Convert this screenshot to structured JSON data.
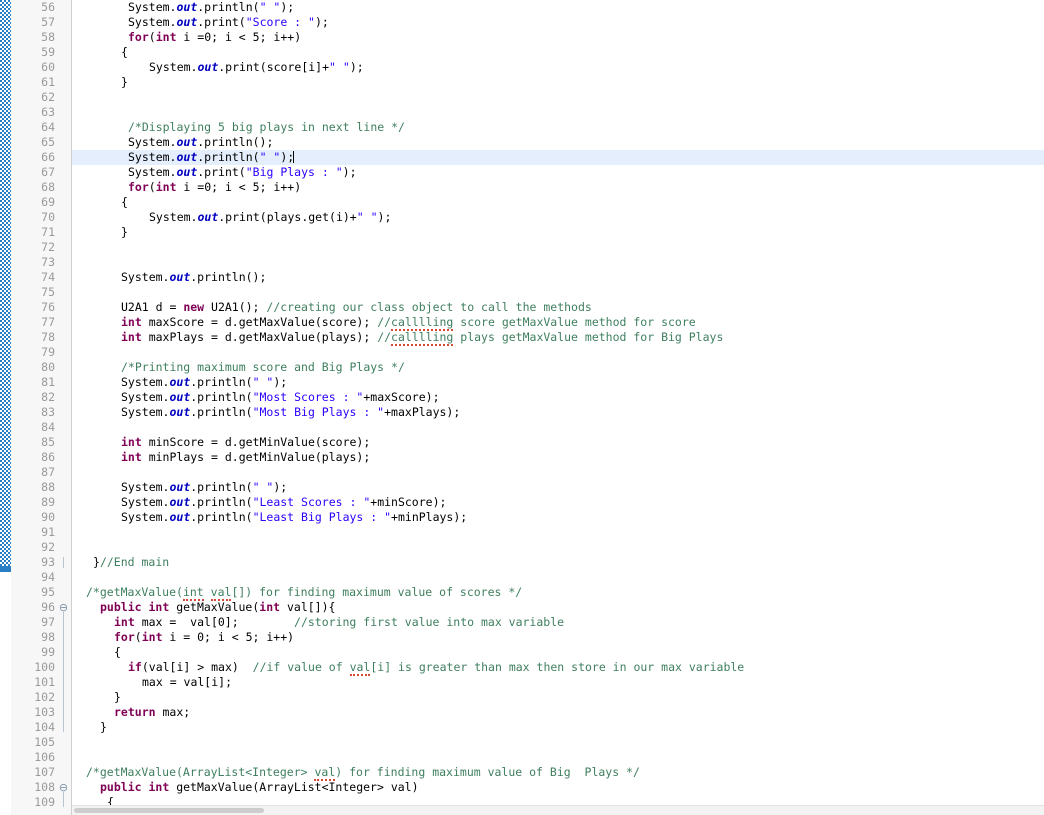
{
  "editor": {
    "language": "Java",
    "first_line": 56,
    "line_height": 15,
    "active_line": 66,
    "colors": {
      "background": "#ffffff",
      "gutter_background": "#f7f7f7",
      "line_number": "#9a9a9a",
      "active_line_highlight": "#e4eefc",
      "keyword": "#7f0055",
      "string": "#2a00ff",
      "comment": "#3f7f5f",
      "static_field": "#0000c0",
      "text": "#000000",
      "change_bar": "#2a7fc4",
      "spellcheck_underline": "#d84a38"
    },
    "fold_markers": [
      {
        "line": 96,
        "glyph": "⊖",
        "state": "expanded"
      },
      {
        "line": 108,
        "glyph": "⊖",
        "state": "expanded"
      }
    ],
    "scrollbar": {
      "orientation": "horizontal",
      "thumb_label": "horizontal-scroll-thumb"
    }
  },
  "lines": [
    {
      "n": 56,
      "indent": 8,
      "tokens": [
        {
          "t": "plain",
          "s": "System."
        },
        {
          "t": "fld",
          "s": "out"
        },
        {
          "t": "plain",
          "s": ".println("
        },
        {
          "t": "str",
          "s": "\" \""
        },
        {
          "t": "plain",
          "s": ");"
        }
      ]
    },
    {
      "n": 57,
      "indent": 8,
      "tokens": [
        {
          "t": "plain",
          "s": "System."
        },
        {
          "t": "fld",
          "s": "out"
        },
        {
          "t": "plain",
          "s": ".print("
        },
        {
          "t": "str",
          "s": "\"Score : \""
        },
        {
          "t": "plain",
          "s": ");"
        }
      ]
    },
    {
      "n": 58,
      "indent": 8,
      "tokens": [
        {
          "t": "kw",
          "s": "for"
        },
        {
          "t": "plain",
          "s": "("
        },
        {
          "t": "kw",
          "s": "int"
        },
        {
          "t": "plain",
          "s": " i =0; i < 5; i++)"
        }
      ]
    },
    {
      "n": 59,
      "indent": 7,
      "tokens": [
        {
          "t": "plain",
          "s": "{"
        }
      ]
    },
    {
      "n": 60,
      "indent": 11,
      "tokens": [
        {
          "t": "plain",
          "s": "System."
        },
        {
          "t": "fld",
          "s": "out"
        },
        {
          "t": "plain",
          "s": ".print(score[i]+"
        },
        {
          "t": "str",
          "s": "\" \""
        },
        {
          "t": "plain",
          "s": ");"
        }
      ]
    },
    {
      "n": 61,
      "indent": 7,
      "tokens": [
        {
          "t": "plain",
          "s": "}"
        }
      ]
    },
    {
      "n": 62,
      "indent": 0,
      "tokens": []
    },
    {
      "n": 63,
      "indent": 0,
      "tokens": []
    },
    {
      "n": 64,
      "indent": 8,
      "tokens": [
        {
          "t": "cmt",
          "s": "/*Displaying 5 big plays in next line */"
        }
      ]
    },
    {
      "n": 65,
      "indent": 8,
      "tokens": [
        {
          "t": "plain",
          "s": "System."
        },
        {
          "t": "fld",
          "s": "out"
        },
        {
          "t": "plain",
          "s": ".println();"
        }
      ]
    },
    {
      "n": 66,
      "indent": 8,
      "active": true,
      "tokens": [
        {
          "t": "plain",
          "s": "System."
        },
        {
          "t": "fld",
          "s": "out"
        },
        {
          "t": "plain",
          "s": ".println("
        },
        {
          "t": "str",
          "s": "\" \""
        },
        {
          "t": "plain",
          "s": ");"
        },
        {
          "t": "caret",
          "s": ""
        }
      ]
    },
    {
      "n": 67,
      "indent": 8,
      "tokens": [
        {
          "t": "plain",
          "s": "System."
        },
        {
          "t": "fld",
          "s": "out"
        },
        {
          "t": "plain",
          "s": ".print("
        },
        {
          "t": "str",
          "s": "\"Big Plays : \""
        },
        {
          "t": "plain",
          "s": ");"
        }
      ]
    },
    {
      "n": 68,
      "indent": 8,
      "tokens": [
        {
          "t": "kw",
          "s": "for"
        },
        {
          "t": "plain",
          "s": "("
        },
        {
          "t": "kw",
          "s": "int"
        },
        {
          "t": "plain",
          "s": " i =0; i < 5; i++)"
        }
      ]
    },
    {
      "n": 69,
      "indent": 7,
      "tokens": [
        {
          "t": "plain",
          "s": "{"
        }
      ]
    },
    {
      "n": 70,
      "indent": 11,
      "tokens": [
        {
          "t": "plain",
          "s": "System."
        },
        {
          "t": "fld",
          "s": "out"
        },
        {
          "t": "plain",
          "s": ".print(plays.get(i)+"
        },
        {
          "t": "str",
          "s": "\" \""
        },
        {
          "t": "plain",
          "s": ");"
        }
      ]
    },
    {
      "n": 71,
      "indent": 7,
      "tokens": [
        {
          "t": "plain",
          "s": "}"
        }
      ]
    },
    {
      "n": 72,
      "indent": 0,
      "tokens": []
    },
    {
      "n": 73,
      "indent": 0,
      "tokens": []
    },
    {
      "n": 74,
      "indent": 7,
      "tokens": [
        {
          "t": "plain",
          "s": "System."
        },
        {
          "t": "fld",
          "s": "out"
        },
        {
          "t": "plain",
          "s": ".println();"
        }
      ]
    },
    {
      "n": 75,
      "indent": 0,
      "tokens": []
    },
    {
      "n": 76,
      "indent": 7,
      "tokens": [
        {
          "t": "plain",
          "s": "U2A1 d = "
        },
        {
          "t": "kw",
          "s": "new"
        },
        {
          "t": "plain",
          "s": " U2A1(); "
        },
        {
          "t": "cmt",
          "s": "//creating our class object to call the methods"
        }
      ]
    },
    {
      "n": 77,
      "indent": 7,
      "tokens": [
        {
          "t": "kw",
          "s": "int"
        },
        {
          "t": "plain",
          "s": " maxScore = d.getMaxValue(score); "
        },
        {
          "t": "cmt",
          "s": "//"
        },
        {
          "t": "cmt-spell",
          "s": "calllling"
        },
        {
          "t": "cmt",
          "s": " score getMaxValue method for score"
        }
      ]
    },
    {
      "n": 78,
      "indent": 7,
      "tokens": [
        {
          "t": "kw",
          "s": "int"
        },
        {
          "t": "plain",
          "s": " maxPlays = d.getMaxValue(plays); "
        },
        {
          "t": "cmt",
          "s": "//"
        },
        {
          "t": "cmt-spell",
          "s": "calllling"
        },
        {
          "t": "cmt",
          "s": " plays getMaxValue method for Big Plays"
        }
      ]
    },
    {
      "n": 79,
      "indent": 0,
      "tokens": []
    },
    {
      "n": 80,
      "indent": 7,
      "tokens": [
        {
          "t": "cmt",
          "s": "/*Printing maximum score and Big Plays */"
        }
      ]
    },
    {
      "n": 81,
      "indent": 7,
      "tokens": [
        {
          "t": "plain",
          "s": "System."
        },
        {
          "t": "fld",
          "s": "out"
        },
        {
          "t": "plain",
          "s": ".println("
        },
        {
          "t": "str",
          "s": "\" \""
        },
        {
          "t": "plain",
          "s": ");"
        }
      ]
    },
    {
      "n": 82,
      "indent": 7,
      "tokens": [
        {
          "t": "plain",
          "s": "System."
        },
        {
          "t": "fld",
          "s": "out"
        },
        {
          "t": "plain",
          "s": ".println("
        },
        {
          "t": "str",
          "s": "\"Most Scores : \""
        },
        {
          "t": "plain",
          "s": "+maxScore);"
        }
      ]
    },
    {
      "n": 83,
      "indent": 7,
      "tokens": [
        {
          "t": "plain",
          "s": "System."
        },
        {
          "t": "fld",
          "s": "out"
        },
        {
          "t": "plain",
          "s": ".println("
        },
        {
          "t": "str",
          "s": "\"Most Big Plays : \""
        },
        {
          "t": "plain",
          "s": "+maxPlays);"
        }
      ]
    },
    {
      "n": 84,
      "indent": 0,
      "tokens": []
    },
    {
      "n": 85,
      "indent": 7,
      "tokens": [
        {
          "t": "kw",
          "s": "int"
        },
        {
          "t": "plain",
          "s": " minScore = d.getMinValue(score);"
        }
      ]
    },
    {
      "n": 86,
      "indent": 7,
      "tokens": [
        {
          "t": "kw",
          "s": "int"
        },
        {
          "t": "plain",
          "s": " minPlays = d.getMinValue(plays);"
        }
      ]
    },
    {
      "n": 87,
      "indent": 0,
      "tokens": []
    },
    {
      "n": 88,
      "indent": 7,
      "tokens": [
        {
          "t": "plain",
          "s": "System."
        },
        {
          "t": "fld",
          "s": "out"
        },
        {
          "t": "plain",
          "s": ".println("
        },
        {
          "t": "str",
          "s": "\" \""
        },
        {
          "t": "plain",
          "s": ");"
        }
      ]
    },
    {
      "n": 89,
      "indent": 7,
      "tokens": [
        {
          "t": "plain",
          "s": "System."
        },
        {
          "t": "fld",
          "s": "out"
        },
        {
          "t": "plain",
          "s": ".println("
        },
        {
          "t": "str",
          "s": "\"Least Scores : \""
        },
        {
          "t": "plain",
          "s": "+minScore);"
        }
      ]
    },
    {
      "n": 90,
      "indent": 7,
      "tokens": [
        {
          "t": "plain",
          "s": "System."
        },
        {
          "t": "fld",
          "s": "out"
        },
        {
          "t": "plain",
          "s": ".println("
        },
        {
          "t": "str",
          "s": "\"Least Big Plays : \""
        },
        {
          "t": "plain",
          "s": "+minPlays);"
        }
      ]
    },
    {
      "n": 91,
      "indent": 0,
      "tokens": []
    },
    {
      "n": 92,
      "indent": 0,
      "tokens": []
    },
    {
      "n": 93,
      "indent": 3,
      "tokens": [
        {
          "t": "plain",
          "s": "}"
        },
        {
          "t": "cmt",
          "s": "//End main"
        }
      ]
    },
    {
      "n": 94,
      "indent": 0,
      "tokens": []
    },
    {
      "n": 95,
      "indent": 2,
      "tokens": [
        {
          "t": "cmt",
          "s": "/*getMaxValue("
        },
        {
          "t": "cmt-spell",
          "s": "int"
        },
        {
          "t": "cmt",
          "s": " "
        },
        {
          "t": "cmt-spell",
          "s": "val"
        },
        {
          "t": "cmt",
          "s": "[]) for finding maximum value of scores */"
        }
      ]
    },
    {
      "n": 96,
      "indent": 4,
      "tokens": [
        {
          "t": "kw",
          "s": "public"
        },
        {
          "t": "plain",
          "s": " "
        },
        {
          "t": "kw",
          "s": "int"
        },
        {
          "t": "plain",
          "s": " getMaxValue("
        },
        {
          "t": "kw",
          "s": "int"
        },
        {
          "t": "plain",
          "s": " val[]){"
        }
      ]
    },
    {
      "n": 97,
      "indent": 6,
      "tokens": [
        {
          "t": "kw",
          "s": "int"
        },
        {
          "t": "plain",
          "s": " max =  val[0];        "
        },
        {
          "t": "cmt",
          "s": "//storing first value into max variable"
        }
      ]
    },
    {
      "n": 98,
      "indent": 6,
      "tokens": [
        {
          "t": "kw",
          "s": "for"
        },
        {
          "t": "plain",
          "s": "("
        },
        {
          "t": "kw",
          "s": "int"
        },
        {
          "t": "plain",
          "s": " i = 0; i < 5; i++)"
        }
      ]
    },
    {
      "n": 99,
      "indent": 6,
      "tokens": [
        {
          "t": "plain",
          "s": "{"
        }
      ]
    },
    {
      "n": 100,
      "indent": 8,
      "tokens": [
        {
          "t": "kw",
          "s": "if"
        },
        {
          "t": "plain",
          "s": "(val[i] > max)  "
        },
        {
          "t": "cmt",
          "s": "//if value of "
        },
        {
          "t": "cmt-spell",
          "s": "val"
        },
        {
          "t": "cmt",
          "s": "[i] is greater than max then store in our max variable"
        }
      ]
    },
    {
      "n": 101,
      "indent": 10,
      "tokens": [
        {
          "t": "plain",
          "s": "max = val[i];"
        }
      ]
    },
    {
      "n": 102,
      "indent": 6,
      "tokens": [
        {
          "t": "plain",
          "s": "}"
        }
      ]
    },
    {
      "n": 103,
      "indent": 6,
      "tokens": [
        {
          "t": "kw",
          "s": "return"
        },
        {
          "t": "plain",
          "s": " max;"
        }
      ]
    },
    {
      "n": 104,
      "indent": 4,
      "tokens": [
        {
          "t": "plain",
          "s": "}"
        }
      ]
    },
    {
      "n": 105,
      "indent": 0,
      "tokens": []
    },
    {
      "n": 106,
      "indent": 0,
      "tokens": []
    },
    {
      "n": 107,
      "indent": 2,
      "tokens": [
        {
          "t": "cmt",
          "s": "/*getMaxValue(ArrayList<Integer> "
        },
        {
          "t": "cmt-spell",
          "s": "val"
        },
        {
          "t": "cmt",
          "s": ") for finding maximum value of Big  Plays */"
        }
      ]
    },
    {
      "n": 108,
      "indent": 4,
      "tokens": [
        {
          "t": "kw",
          "s": "public"
        },
        {
          "t": "plain",
          "s": " "
        },
        {
          "t": "kw",
          "s": "int"
        },
        {
          "t": "plain",
          "s": " getMaxValue(ArrayList<Integer> val)"
        }
      ]
    },
    {
      "n": 109,
      "indent": 5,
      "tokens": [
        {
          "t": "plain",
          "s": "{"
        }
      ]
    }
  ]
}
